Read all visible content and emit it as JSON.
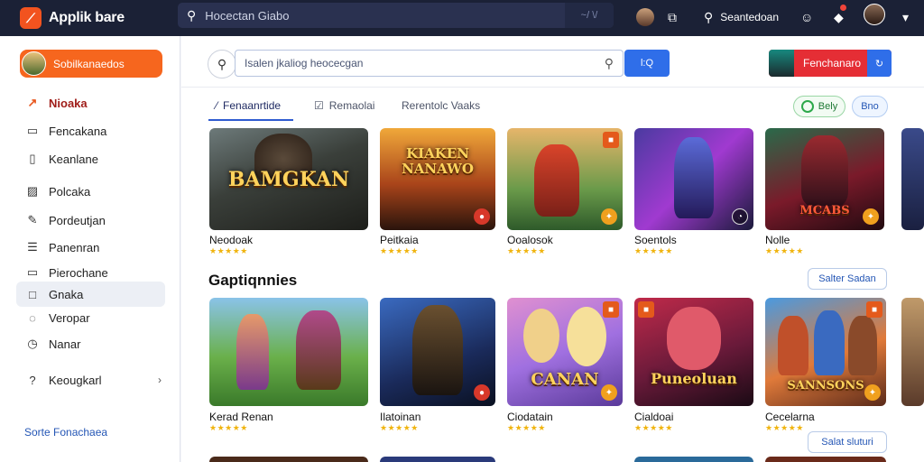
{
  "topbar": {
    "brand": "Applik bare",
    "search_text": "Hocectan Giabo",
    "search_tail": "~/ \\/",
    "user_text": "Seantedoan"
  },
  "sidebar": {
    "cta_label": "Sobilkanaedos",
    "items": [
      {
        "label": "Nioaka",
        "icon": "trending-icon"
      },
      {
        "label": "Fencakana",
        "icon": "folder-icon"
      },
      {
        "label": "Keanlane",
        "icon": "bookmark-icon"
      },
      {
        "label": "Polcaka",
        "icon": "image-icon"
      },
      {
        "label": "Pordeutjan",
        "icon": "pencil-icon"
      },
      {
        "label": "Panenran",
        "icon": "list-icon"
      },
      {
        "label": "Pierochane",
        "icon": "folder-icon"
      },
      {
        "label": "Gnaka",
        "icon": "square-icon"
      },
      {
        "label": "Veropar",
        "icon": "chat-icon"
      },
      {
        "label": "Nanar",
        "icon": "clock-icon"
      },
      {
        "label": "Keougkarl",
        "icon": "question-icon"
      }
    ],
    "footer": "Sorte Fonachaea"
  },
  "main": {
    "search_placeholder": "Isalen jkaliog  heocecgan",
    "search_button": "l:Q",
    "promo_label": "Fenchanaro",
    "tabs": [
      "Fenaanrtide",
      "Remaolai",
      "Rerentolc  Vaaks"
    ],
    "pill_green": "Bely",
    "pill_blue": "Bno",
    "section_title": "Gaptiqnnies",
    "section_button": "Salter Sadan",
    "bottom_button": "Salat sluturi",
    "stars": "★★★★★"
  },
  "row1": [
    {
      "name": "Neodoak",
      "art": "BAMGKAN"
    },
    {
      "name": "Peitkaia",
      "art": "KIAKEN\nNANAWO"
    },
    {
      "name": "Ooalosok",
      "art": ""
    },
    {
      "name": "Soentols",
      "art": ""
    },
    {
      "name": "Nolle",
      "art": "MCABS"
    }
  ],
  "row2": [
    {
      "name": "Kerad Renan",
      "art": ""
    },
    {
      "name": "Ilatoinan",
      "art": ""
    },
    {
      "name": "Ciodatain",
      "art": "CANAN"
    },
    {
      "name": "Cialdoai",
      "art": "Puneoluan"
    },
    {
      "name": "Cecelarna",
      "art": "SANNSONS"
    }
  ],
  "colors": {
    "topbar": "#1b2136",
    "accent_orange": "#f6661e",
    "accent_blue": "#2f6ee9",
    "accent_red": "#e52e35",
    "star": "#f0b40f"
  }
}
